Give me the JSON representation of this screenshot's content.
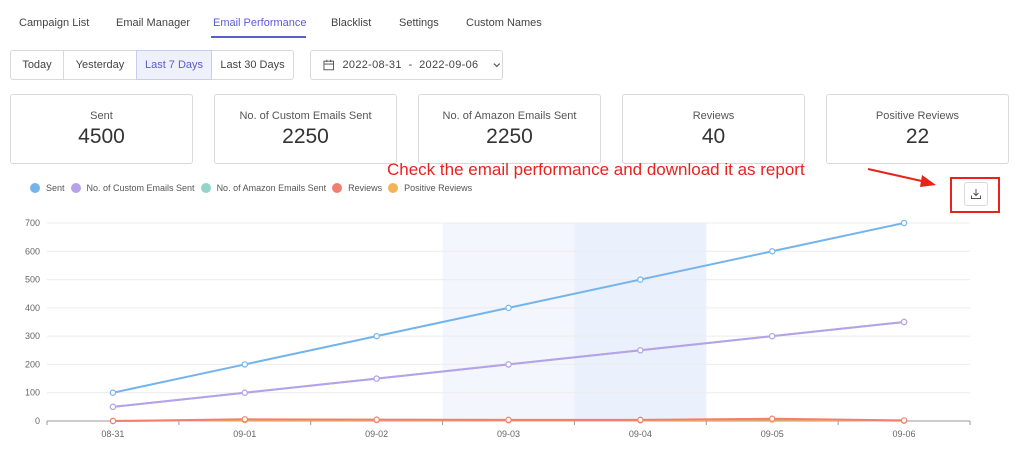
{
  "tabs": [
    {
      "label": "Campaign List",
      "active": false
    },
    {
      "label": "Email Manager",
      "active": false
    },
    {
      "label": "Email Performance",
      "active": true
    },
    {
      "label": "Blacklist",
      "active": false
    },
    {
      "label": "Settings",
      "active": false
    },
    {
      "label": "Custom Names",
      "active": false
    }
  ],
  "ranges": [
    {
      "label": "Today",
      "active": false
    },
    {
      "label": "Yesterday",
      "active": false
    },
    {
      "label": "Last 7 Days",
      "active": true
    },
    {
      "label": "Last 30 Days",
      "active": false
    }
  ],
  "date_range": {
    "text": "2022-08-31  -  2022-09-06",
    "icon": "calendar-icon"
  },
  "cards": [
    {
      "label": "Sent",
      "value": "4500"
    },
    {
      "label": "No. of Custom Emails Sent",
      "value": "2250"
    },
    {
      "label": "No. of Amazon Emails Sent",
      "value": "2250"
    },
    {
      "label": "Reviews",
      "value": "40"
    },
    {
      "label": "Positive Reviews",
      "value": "22"
    }
  ],
  "annotation": {
    "text": "Check the email performance and download it as report",
    "color": "#e8231b"
  },
  "download": {
    "icon": "download-icon"
  },
  "colors": {
    "accent": "#5b5bd6"
  },
  "chart_data": {
    "type": "line",
    "categories": [
      "08-31",
      "09-01",
      "09-02",
      "09-03",
      "09-04",
      "09-05",
      "09-06"
    ],
    "ylim": [
      0,
      700
    ],
    "yticks": [
      "0",
      "100",
      "200",
      "300",
      "400",
      "500",
      "600",
      "700"
    ],
    "grid": true,
    "legend_position": "top-left",
    "highlighted_categories": [
      "09-03",
      "09-04"
    ],
    "series": [
      {
        "name": "Sent",
        "color": "#74b4ea",
        "values": [
          100,
          200,
          300,
          400,
          500,
          600,
          700
        ]
      },
      {
        "name": "No. of Custom Emails Sent",
        "color": "#b7a1e8",
        "values": [
          50,
          100,
          150,
          200,
          250,
          300,
          350
        ]
      },
      {
        "name": "No. of Amazon Emails Sent",
        "color": "#92d4c7",
        "values": [
          50,
          100,
          150,
          200,
          250,
          300,
          350
        ]
      },
      {
        "name": "Reviews",
        "color": "#f07f72",
        "values": [
          0,
          6,
          5,
          4,
          4,
          8,
          2
        ]
      },
      {
        "name": "Positive Reviews",
        "color": "#f4b35a",
        "values": [
          0,
          3,
          3,
          2,
          2,
          5,
          1
        ]
      }
    ]
  }
}
